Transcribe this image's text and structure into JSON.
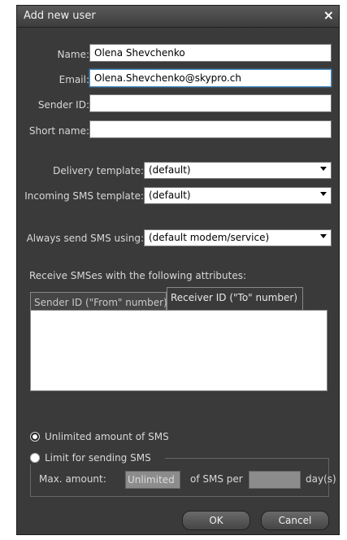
{
  "dialog": {
    "title": "Add new user",
    "close_glyph": "×"
  },
  "fields": {
    "name": {
      "label": "Name:",
      "value": "Olena Shevchenko"
    },
    "email": {
      "label": "Email:",
      "value": "Olena.Shevchenko@skypro.ch"
    },
    "sender_id": {
      "label": "Sender ID:",
      "value": ""
    },
    "short_name": {
      "label": "Short name:",
      "value": ""
    }
  },
  "templates": {
    "delivery": {
      "label": "Delivery template:",
      "value": "(default)"
    },
    "incoming": {
      "label": "Incoming SMS template:",
      "value": "(default)"
    },
    "always_send": {
      "label": "Always send SMS using:",
      "value": "(default modem/service)"
    }
  },
  "receive": {
    "heading": "Receive SMSes with the following attributes:",
    "tabs": [
      {
        "label": "Sender ID (\"From\" number)",
        "active": false
      },
      {
        "label": "Receiver ID (\"To\" number)",
        "active": true
      }
    ]
  },
  "limits": {
    "unlimited_label": "Unlimited amount of SMS",
    "unlimited_selected": true,
    "limit_label": "Limit for sending SMS",
    "max_amount_label": "Max. amount:",
    "max_amount_value": "Unlimited",
    "of_sms_per_label": "of SMS per",
    "period_value": "",
    "days_label": "day(s)"
  },
  "buttons": {
    "ok": "OK",
    "cancel": "Cancel"
  },
  "colors": {
    "panel": "#3a3a3a",
    "focus": "#4a90c8"
  }
}
